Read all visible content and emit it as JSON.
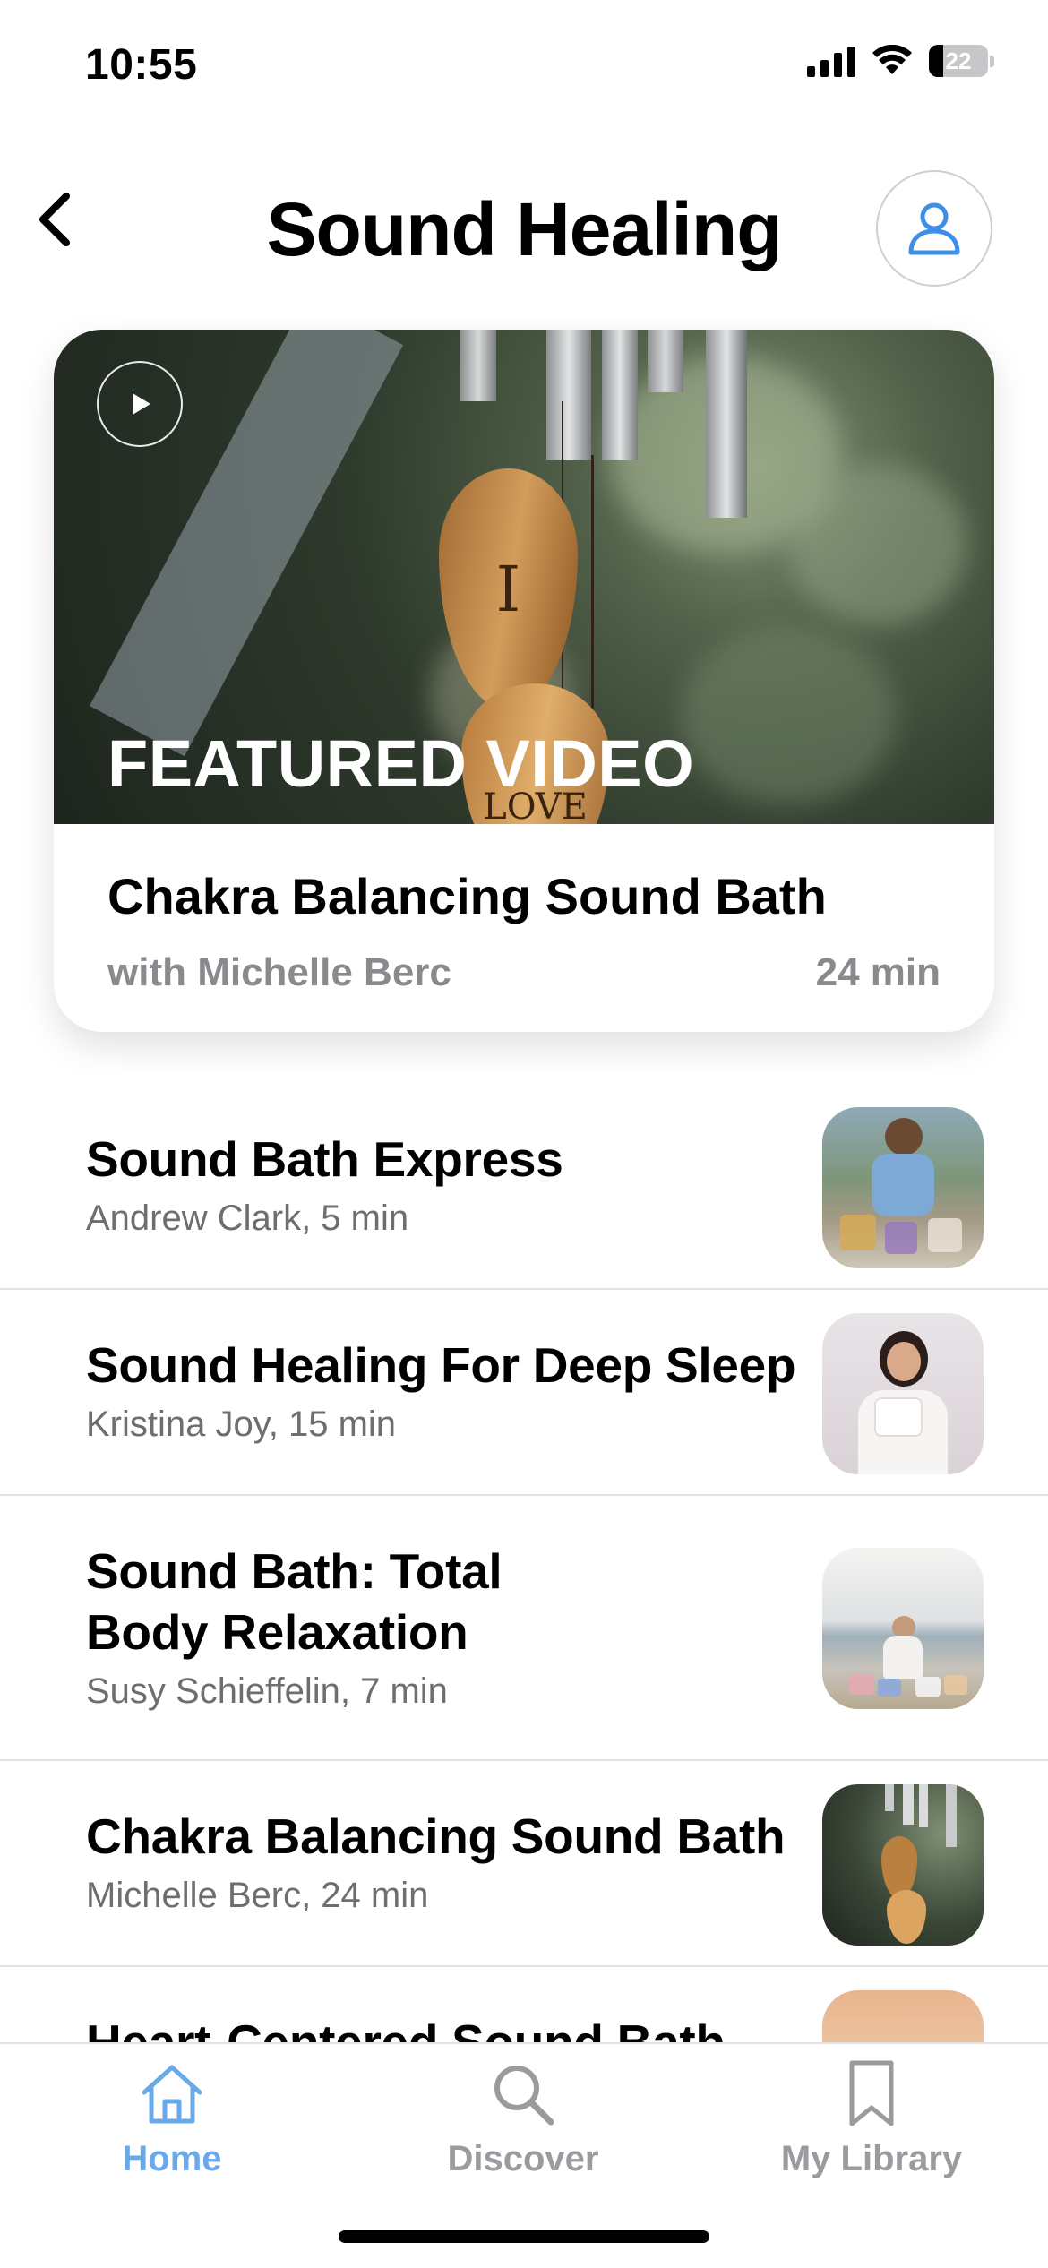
{
  "status_bar": {
    "time": "10:55",
    "battery": "22"
  },
  "header": {
    "title": "Sound Healing"
  },
  "featured": {
    "label": "FEATURED VIDEO",
    "title": "Chakra Balancing Sound Bath",
    "instructor": "with Michelle Berc",
    "duration": "24 min",
    "image_text": {
      "top": "I",
      "bottom": "LOVE"
    }
  },
  "sessions": [
    {
      "title": "Sound Bath Express",
      "meta": "Andrew Clark, 5 min"
    },
    {
      "title": "Sound Healing For Deep Sleep",
      "meta": "Kristina Joy, 15 min"
    },
    {
      "title": "Sound Bath: Total Body Relaxation",
      "meta": "Susy Schieffelin, 7 min"
    },
    {
      "title": "Chakra Balancing Sound Bath",
      "meta": "Michelle Berc, 24 min"
    },
    {
      "title": "Heart-Centered Sound Bath",
      "meta": ""
    }
  ],
  "tab_bar": {
    "tabs": [
      {
        "label": "Home",
        "icon": "home-icon",
        "active": true
      },
      {
        "label": "Discover",
        "icon": "search-icon",
        "active": false
      },
      {
        "label": "My Library",
        "icon": "bookmark-icon",
        "active": false
      }
    ]
  },
  "colors": {
    "accent": "#6aa9e9",
    "inactive_tab": "#9b9b9f",
    "secondary_text": "#6d6d72"
  }
}
